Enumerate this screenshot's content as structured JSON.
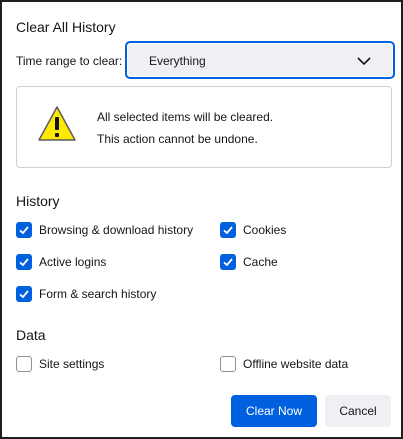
{
  "dialog": {
    "title": "Clear All History",
    "time_range_label": "Time range to clear:",
    "time_range_value": "Everything"
  },
  "warning": {
    "line1": "All selected items will be cleared.",
    "line2": "This action cannot be undone."
  },
  "history": {
    "heading": "History",
    "items": [
      {
        "label": "Browsing & download history",
        "checked": true
      },
      {
        "label": "Cookies",
        "checked": true
      },
      {
        "label": "Active logins",
        "checked": true
      },
      {
        "label": "Cache",
        "checked": true
      },
      {
        "label": "Form & search history",
        "checked": true
      }
    ]
  },
  "data": {
    "heading": "Data",
    "items": [
      {
        "label": "Site settings",
        "checked": false
      },
      {
        "label": "Offline website data",
        "checked": false
      }
    ]
  },
  "buttons": {
    "clear_now": "Clear Now",
    "cancel": "Cancel"
  },
  "colors": {
    "accent": "#0061e0",
    "warning_yellow": "#ffe900"
  },
  "icons": {
    "warning": "warning-triangle-icon",
    "dropdown": "chevron-down-icon",
    "checkmark": "checkmark-icon"
  }
}
